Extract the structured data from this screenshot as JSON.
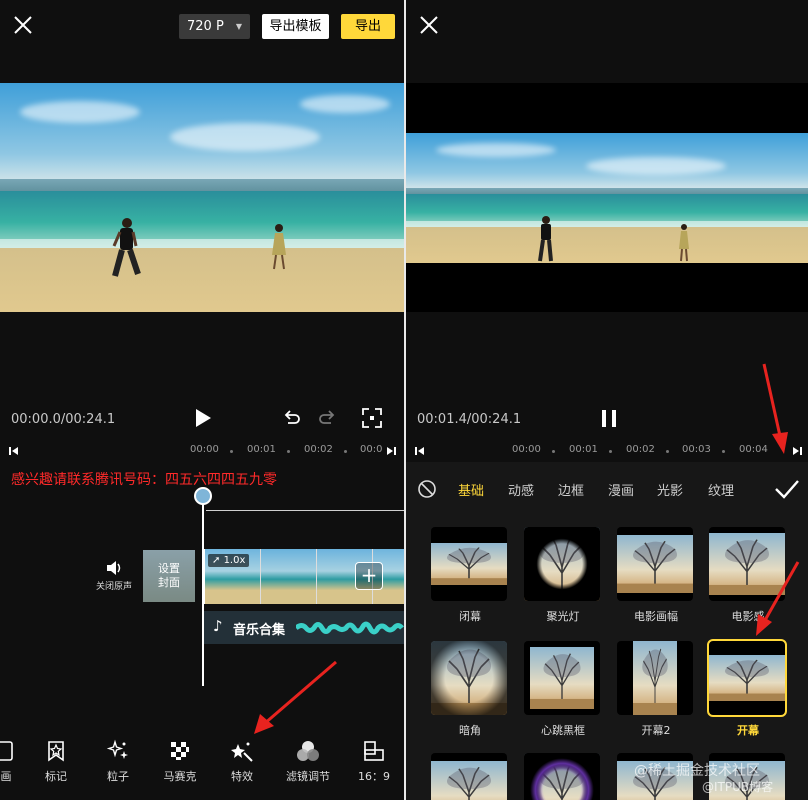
{
  "left_panel": {
    "resolution": "720 P",
    "export_template_label": "导出模板",
    "export_label": "导出",
    "timecode": "00:00.0/00:24.1",
    "ruler_ticks": [
      "00:00",
      "00:01",
      "00:02",
      "00:0"
    ],
    "promo_text": "感兴趣请联系腾讯号码：四五六四四五九零",
    "mute_label": "关闭原声",
    "cover_label_1": "设置",
    "cover_label_2": "封面",
    "speed_label": "1.0x",
    "add_clip": "+",
    "music_track": "音乐合集",
    "toolbar": [
      "画",
      "标记",
      "粒子",
      "马赛克",
      "特效",
      "滤镜调节",
      "16：9"
    ]
  },
  "right_panel": {
    "timecode": "00:01.4/00:24.1",
    "ruler_ticks": [
      "00:00",
      "00:01",
      "00:02",
      "00:03",
      "00:04"
    ],
    "tabs": [
      "基础",
      "动感",
      "边框",
      "漫画",
      "光影",
      "纹理"
    ],
    "active_tab": "基础",
    "effects_row1": [
      "闭幕",
      "聚光灯",
      "电影画幅",
      "电影感"
    ],
    "effects_row2": [
      "暗角",
      "心跳黑框",
      "开幕2",
      "开幕"
    ],
    "selected_effect": "开幕",
    "watermark": "@稀土掘金技术社区",
    "watermark2": "@ITPUB博客"
  },
  "colors": {
    "accent": "#ffd83a",
    "promo": "#ff2a2a",
    "arrow": "#e8231f"
  }
}
